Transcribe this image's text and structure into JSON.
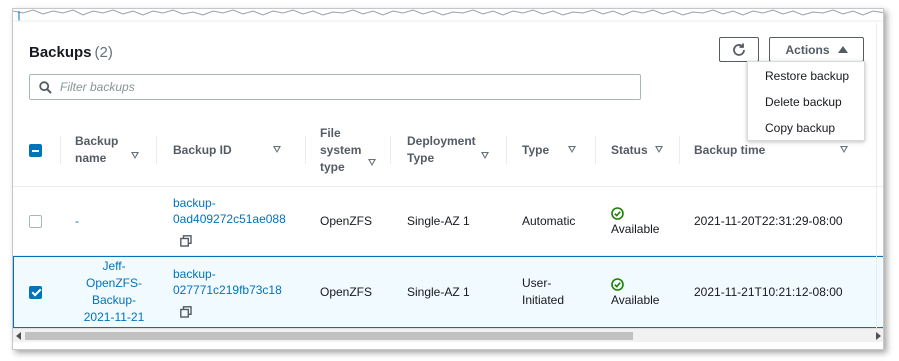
{
  "panel": {
    "title": "Backups",
    "count": "(2)"
  },
  "toolbar": {
    "refresh_icon": "refresh-icon",
    "actions_label": "Actions"
  },
  "search": {
    "placeholder": "Filter backups"
  },
  "actions_menu": {
    "items": [
      "Restore backup",
      "Delete backup",
      "Copy backup"
    ]
  },
  "table": {
    "headers": {
      "name": "Backup\nname",
      "id": "Backup ID",
      "fs_type": "File\nsystem\ntype",
      "deployment": "Deployment\nType",
      "type": "Type",
      "status": "Status",
      "time": "Backup time"
    },
    "rows": [
      {
        "selected": false,
        "name": "-",
        "id": "backup-\n0ad409272c51ae088",
        "fs_type": "OpenZFS",
        "deployment": "Single-AZ 1",
        "type": "Automatic",
        "status": "Available",
        "time": "2021-11-20T22:31:29-08:00"
      },
      {
        "selected": true,
        "name": "Jeff-\nOpenZFS-\nBackup-\n2021-11-21",
        "id": "backup-\n027771c219fb73c18",
        "fs_type": "OpenZFS",
        "deployment": "Single-AZ 1",
        "type": "User-\nInitiated",
        "status": "Available",
        "time": "2021-11-21T10:21:12-08:00"
      }
    ]
  },
  "colors": {
    "link": "#0073bb",
    "success": "#1d8102",
    "selected_bg": "#f1faff"
  }
}
